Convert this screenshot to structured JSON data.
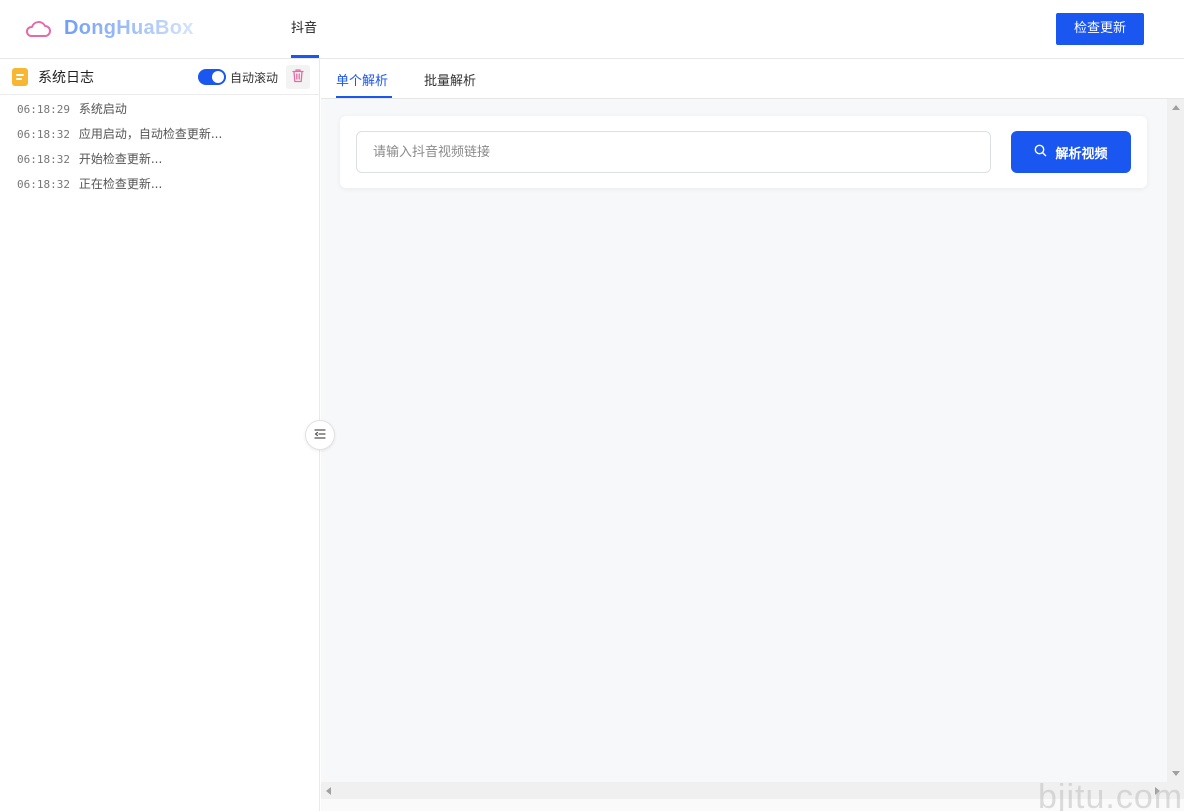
{
  "header": {
    "logo_text": "DongHuaBox",
    "nav_tab": "抖音",
    "check_update_label": "检查更新"
  },
  "log_panel": {
    "title": "系统日志",
    "auto_scroll_label": "自动滚动",
    "auto_scroll_on": true,
    "entries": [
      {
        "time": "06:18:29",
        "msg": "系统启动"
      },
      {
        "time": "06:18:32",
        "msg": "应用启动，自动检查更新..."
      },
      {
        "time": "06:18:32",
        "msg": "开始检查更新..."
      },
      {
        "time": "06:18:32",
        "msg": "正在检查更新..."
      }
    ]
  },
  "content": {
    "tabs": [
      {
        "label": "单个解析",
        "active": true
      },
      {
        "label": "批量解析",
        "active": false
      }
    ],
    "url_input": {
      "placeholder": "请输入抖音视频链接",
      "value": ""
    },
    "parse_button_label": "解析视频"
  },
  "watermark": "bjitu.com",
  "colors": {
    "accent": "#1a56f0",
    "log_icon": "#f7b733",
    "trash_icon": "#e86aa5",
    "logo_cloud": "#e86aa5"
  },
  "icons": {
    "logo": "cloud-icon",
    "log": "document-icon",
    "clear": "trash-icon",
    "collapse": "collapse-left-icon",
    "search": "search-icon"
  }
}
